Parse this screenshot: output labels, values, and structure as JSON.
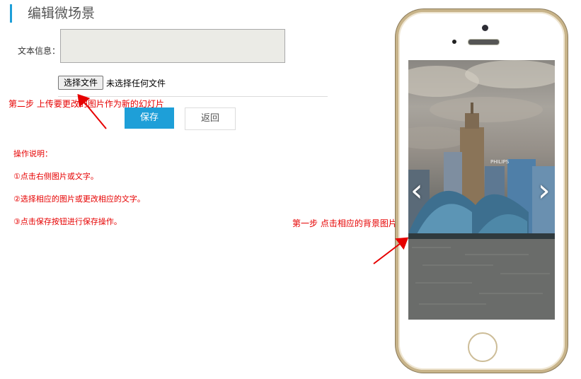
{
  "page": {
    "title": "编辑微场景"
  },
  "form": {
    "text_label": "文本信息：",
    "text_value": "",
    "file_button_label": "选择文件",
    "file_status": "未选择任何文件",
    "save_label": "保存",
    "back_label": "返回"
  },
  "annotations": {
    "step2": "第二步  上传要更改的图片作为新的幻灯片",
    "step1": "第一步  点击相应的背景图片"
  },
  "instructions": {
    "heading": "操作说明：",
    "items": [
      "①点击右侧图片或文字。",
      "②选择相应的图片或更改相应的文字。",
      "③点击保存按钮进行保存操作。"
    ]
  },
  "phone": {
    "slide_prev": "‹",
    "slide_next": "›",
    "building_sign": "PHILIPS"
  },
  "colors": {
    "accent": "#1e9fd8",
    "annotation_red": "#e60000"
  }
}
